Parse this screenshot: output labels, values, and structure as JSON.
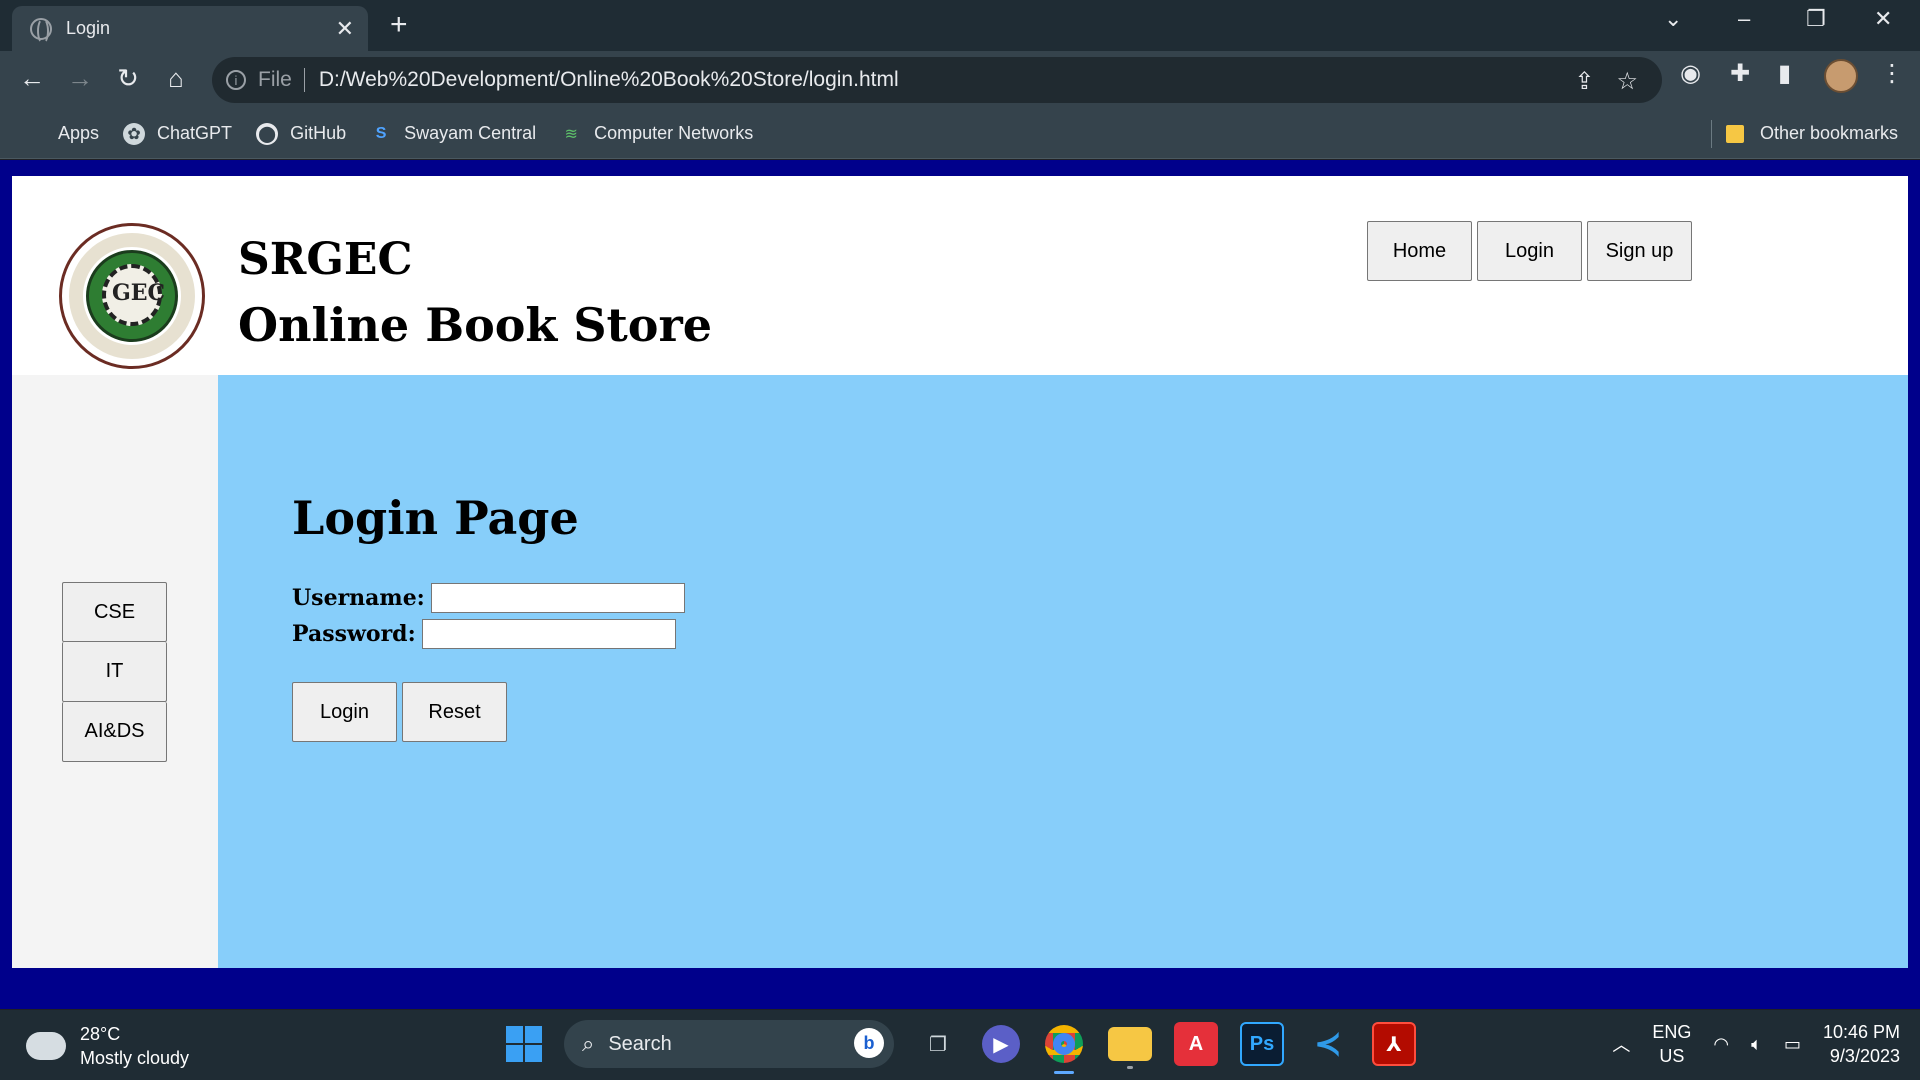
{
  "browser": {
    "tab_title": "Login",
    "tab_close": "✕",
    "new_tab": "+",
    "url_scheme": "File",
    "url": "D:/Web%20Development/Online%20Book%20Store/login.html",
    "bookmarks": [
      {
        "label": "Apps",
        "icon": "apps-icon"
      },
      {
        "label": "ChatGPT",
        "icon": "chatgpt-icon"
      },
      {
        "label": "GitHub",
        "icon": "github-icon"
      },
      {
        "label": "Swayam Central",
        "icon": "swayam-icon"
      },
      {
        "label": "Computer Networks",
        "icon": "computer-networks-icon"
      }
    ],
    "other_bookmarks": "Other bookmarks"
  },
  "header": {
    "brand_line1": "SRGEC",
    "brand_line2": "Online Book Store",
    "logo_mark": "GEC",
    "nav": [
      "Home",
      "Login",
      "Sign up"
    ]
  },
  "sidebar": {
    "items": [
      "CSE",
      "IT",
      "AI&DS"
    ]
  },
  "login": {
    "title": "Login Page",
    "username_label": "Username:",
    "username_value": "",
    "password_label": "Password:",
    "password_value": "",
    "login_button": "Login",
    "reset_button": "Reset"
  },
  "taskbar": {
    "temperature": "28°C",
    "weather": "Mostly cloudy",
    "search_placeholder": "Search",
    "lang_line1": "ENG",
    "lang_line2": "US",
    "time": "10:46 PM",
    "date": "9/3/2023"
  },
  "colors": {
    "page_frame": "#00008b",
    "content_bg": "#87cefa",
    "sidebar_bg": "#f4f4f4",
    "browser_chrome": "#35434c"
  }
}
